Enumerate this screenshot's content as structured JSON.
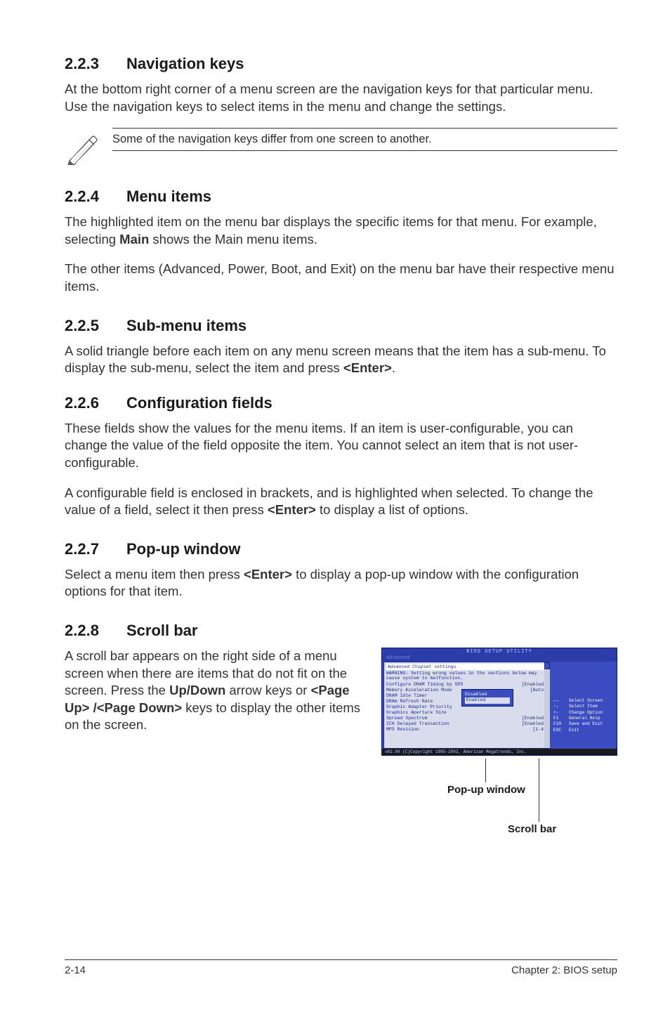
{
  "s223": {
    "num": "2.2.3",
    "title": "Navigation keys",
    "p1": "At the bottom right corner of a menu screen are the navigation keys for that particular menu. Use the navigation keys to select items in the menu and change the settings.",
    "callout": "Some of the navigation keys differ from one screen to another."
  },
  "s224": {
    "num": "2.2.4",
    "title": "Menu items",
    "p1_a": "The highlighted item on the menu bar displays the specific items for that menu. For example, selecting ",
    "p1_b": "Main",
    "p1_c": " shows the Main menu items.",
    "p2": "The other items (Advanced, Power, Boot, and Exit) on the menu bar have their respective menu items."
  },
  "s225": {
    "num": "2.2.5",
    "title": "Sub-menu items",
    "p1_a": "A solid triangle before each item on any menu screen means that the item has a sub-menu. To display the sub-menu, select the item and press ",
    "p1_b": "<Enter>",
    "p1_c": "."
  },
  "s226": {
    "num": "2.2.6",
    "title": "Configuration fields",
    "p1": "These fields show the values for the menu items. If an item is user-configurable, you can change the value of the field opposite the item. You cannot select an item that is not user-configurable.",
    "p2_a": "A configurable field is enclosed in brackets, and is highlighted when selected. To change the value of a field, select it then press ",
    "p2_b": "<Enter>",
    "p2_c": " to display a list of options."
  },
  "s227": {
    "num": "2.2.7",
    "title": "Pop-up window",
    "p1_a": "Select a menu item then press ",
    "p1_b": "<Enter>",
    "p1_c": " to display a pop-up window with the configuration options for that item."
  },
  "s228": {
    "num": "2.2.8",
    "title": "Scroll bar",
    "p1_a": "A scroll bar appears on the right side of a menu screen when there are items that do not fit on the screen. Press the ",
    "p1_b": "Up/Down",
    "p1_c": " arrow keys or ",
    "p1_d": "<Page Up> /<Page Down>",
    "p1_e": " keys to display the other items on the screen."
  },
  "bios": {
    "title": "BIOS SETUP UTILITY",
    "tab": "Advanced",
    "subtitle": "Advanced Chipset settings",
    "warning": "WARNING: Setting wrong values in the sections below may cause system to malfunction.",
    "rows": [
      {
        "l": "Configure DRAM Timing by SPD",
        "v": "[Enabled]"
      },
      {
        "l": "Memory Acceleration Mode",
        "v": "[Auto]"
      },
      {
        "l": "DRAM Idle Timer",
        "v": ""
      },
      {
        "l": "DRAm Refresh Rate",
        "v": ""
      },
      {
        "l": "Graphic Adapter Priority",
        "v": ""
      },
      {
        "l": "Graphics Aperture Size",
        "v": ""
      },
      {
        "l": "Spread Spectrum",
        "v": "[Enabled]"
      },
      {
        "l": "ICH Delayed Transaction",
        "v": "[Enabled]"
      },
      {
        "l": "MPS Revision",
        "v": "[1.4]"
      }
    ],
    "popup": {
      "opt1": "Disabled",
      "opt2": "Enabled"
    },
    "help": [
      {
        "k": "←→",
        "t": "Select Screen"
      },
      {
        "k": "↑↓",
        "t": "Select Item"
      },
      {
        "k": "+-",
        "t": "Change Option"
      },
      {
        "k": "F1",
        "t": "General Help"
      },
      {
        "k": "F10",
        "t": "Save and Exit"
      },
      {
        "k": "ESC",
        "t": "Exit"
      }
    ],
    "foot_l": "v02.00 (C)Copyright 1985-2002, American Megatrends, Inc.",
    "labels": {
      "popup": "Pop-up window",
      "scroll": "Scroll bar"
    }
  },
  "footer": {
    "left": "2-14",
    "right": "Chapter 2: BIOS setup"
  }
}
